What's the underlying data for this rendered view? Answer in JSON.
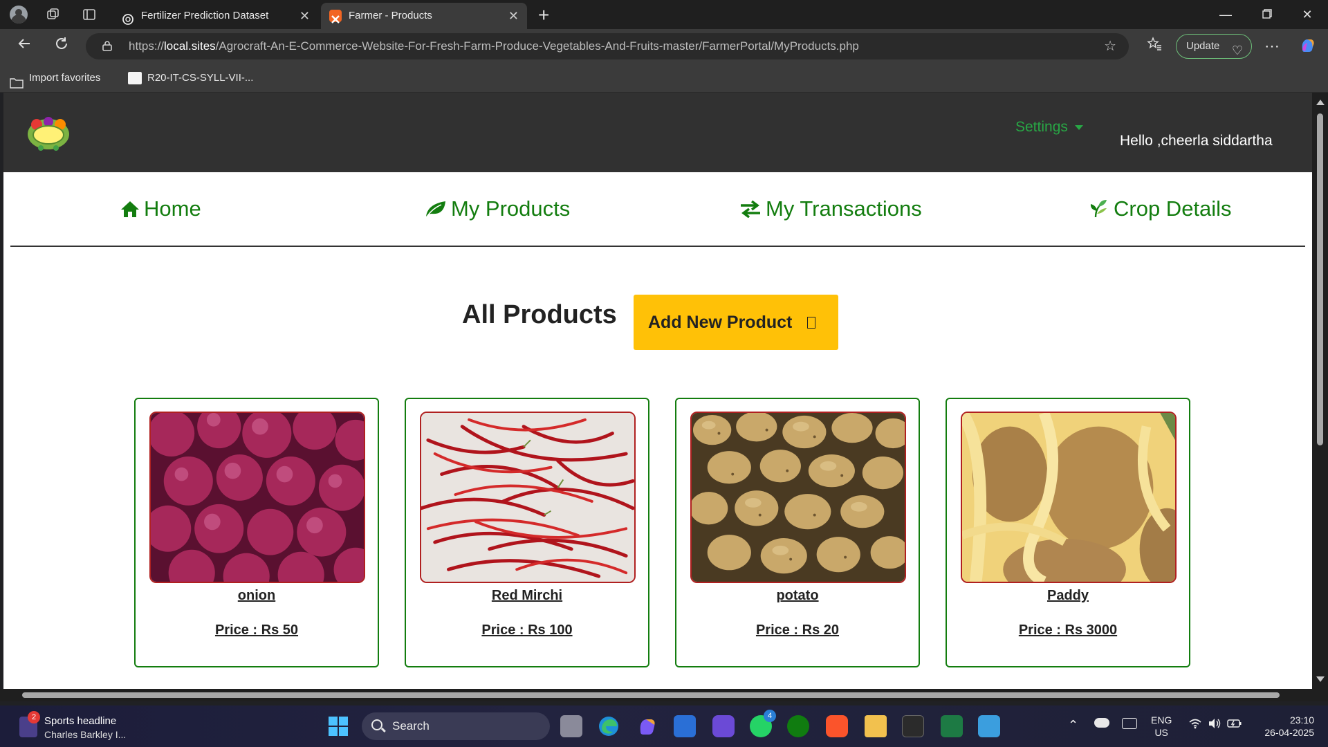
{
  "browser": {
    "tabs": [
      {
        "title": "Fertilizer Prediction Dataset",
        "active": false
      },
      {
        "title": "Farmer - Products",
        "active": true
      }
    ],
    "url_prefix": "https://",
    "url_host": "local.sites",
    "url_path": "/Agrocraft-An-E-Commerce-Website-For-Fresh-Farm-Produce-Vegetables-And-Fruits-master/FarmerPortal/MyProducts.php",
    "update_label": "Update",
    "favorites": [
      {
        "label": "Import favorites"
      },
      {
        "label": "R20-IT-CS-SYLL-VII-..."
      }
    ]
  },
  "site": {
    "settings_label": "Settings",
    "greeting": "Hello ,cheerla siddartha",
    "nav": [
      {
        "label": "Home",
        "icon": "home-icon"
      },
      {
        "label": "My Products",
        "icon": "leaf-icon"
      },
      {
        "label": "My Transactions",
        "icon": "exchange-icon"
      },
      {
        "label": "Crop Details",
        "icon": "crop-icon"
      }
    ],
    "heading": "All Products",
    "add_button": "Add New Product",
    "products": [
      {
        "name": "onion",
        "price": "Price : Rs 50"
      },
      {
        "name": "Red Mirchi",
        "price": "Price : Rs 100"
      },
      {
        "name": "potato",
        "price": "Price : Rs 20"
      },
      {
        "name": "Paddy",
        "price": "Price : Rs 3000"
      }
    ]
  },
  "taskbar": {
    "news_title": "Sports headline",
    "news_sub": "Charles Barkley I...",
    "news_badge": "2",
    "search_label": "Search",
    "whatsapp_badge": "4",
    "lang_top": "ENG",
    "lang_bottom": "US",
    "time": "23:10",
    "date": "26-04-2025"
  },
  "colors": {
    "accent_green": "#137d0f",
    "button_yellow": "#ffc107",
    "header_dark": "#313131"
  }
}
